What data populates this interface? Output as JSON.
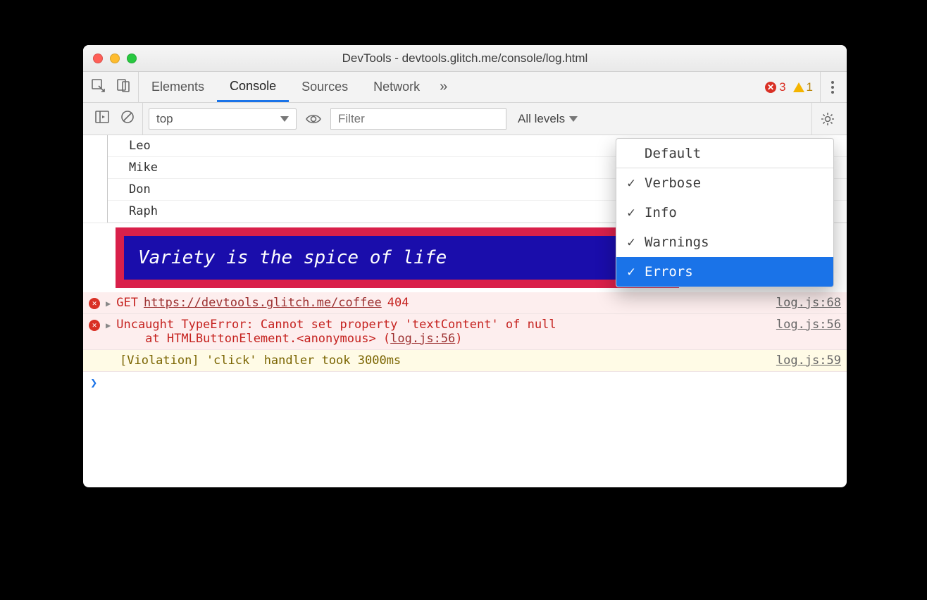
{
  "window": {
    "title": "DevTools - devtools.glitch.me/console/log.html"
  },
  "tabs": {
    "items": [
      "Elements",
      "Console",
      "Sources",
      "Network"
    ],
    "active_index": 1,
    "overflow_glyph": "»"
  },
  "status_badges": {
    "errors": "3",
    "warnings": "1"
  },
  "toolbar": {
    "context": "top",
    "filter_placeholder": "Filter",
    "levels_label": "All levels"
  },
  "levels_menu": {
    "items": [
      {
        "label": "Default",
        "checked": false
      },
      {
        "label": "Verbose",
        "checked": true
      },
      {
        "label": "Info",
        "checked": true
      },
      {
        "label": "Warnings",
        "checked": true
      },
      {
        "label": "Errors",
        "checked": true,
        "selected": true
      }
    ]
  },
  "log_group": {
    "items": [
      "Leo",
      "Mike",
      "Don",
      "Raph"
    ]
  },
  "styled_message": "Variety is the spice of life",
  "errors": [
    {
      "method": "GET",
      "url": "https://devtools.glitch.me/coffee",
      "status": "404",
      "source": "log.js:68"
    },
    {
      "line1": "Uncaught TypeError: Cannot set property 'textContent' of null",
      "line2_prefix": "    at HTMLButtonElement.<anonymous> (",
      "line2_link": "log.js:56",
      "line2_suffix": ")",
      "source": "log.js:56"
    }
  ],
  "violation": {
    "text": "[Violation] 'click' handler took 3000ms",
    "source": "log.js:59"
  },
  "prompt_glyph": "❯"
}
